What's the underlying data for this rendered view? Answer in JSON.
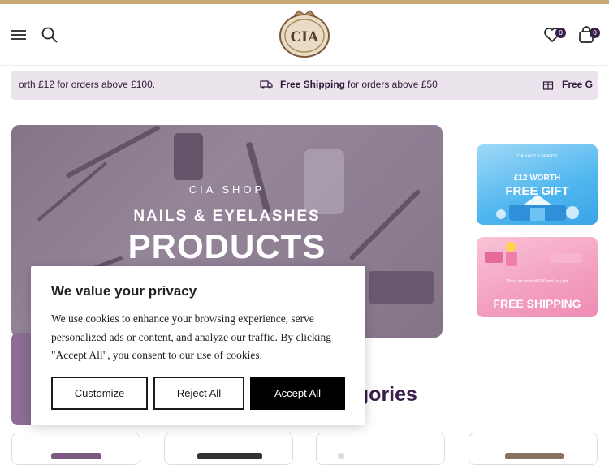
{
  "header": {
    "logo_text": "CIA",
    "wishlist_count": "0",
    "cart_count": "0"
  },
  "ticker": {
    "item1": "orth £12 for orders above £100.",
    "item2_bold": "Free Shipping",
    "item2_rest": "for orders above £50",
    "item3_bold": "Free G"
  },
  "hero": {
    "subtitle": "CIA SHOP",
    "line": "NAILS & EYELASHES",
    "headline": "PRODUCTS"
  },
  "promos": [
    {
      "small": "CIA NAILS & BEAUTY",
      "big1": "£12 WORTH",
      "big2": "FREE GIFT"
    },
    {
      "small": "Place an order of £50 and you get",
      "big": "FREE SHIPPING"
    }
  ],
  "categories": {
    "heading": "egories"
  },
  "cookie": {
    "title": "We value your privacy",
    "text": "We use cookies to enhance your browsing experience, serve personalized ads or content, and analyze our traffic. By clicking \"Accept All\", you consent to our use of cookies.",
    "customize": "Customize",
    "reject": "Reject All",
    "accept": "Accept All"
  },
  "colors": {
    "brand": "#3b1f4b",
    "ticker_bg": "#ebe4ec",
    "topbar": "#c9a877"
  }
}
